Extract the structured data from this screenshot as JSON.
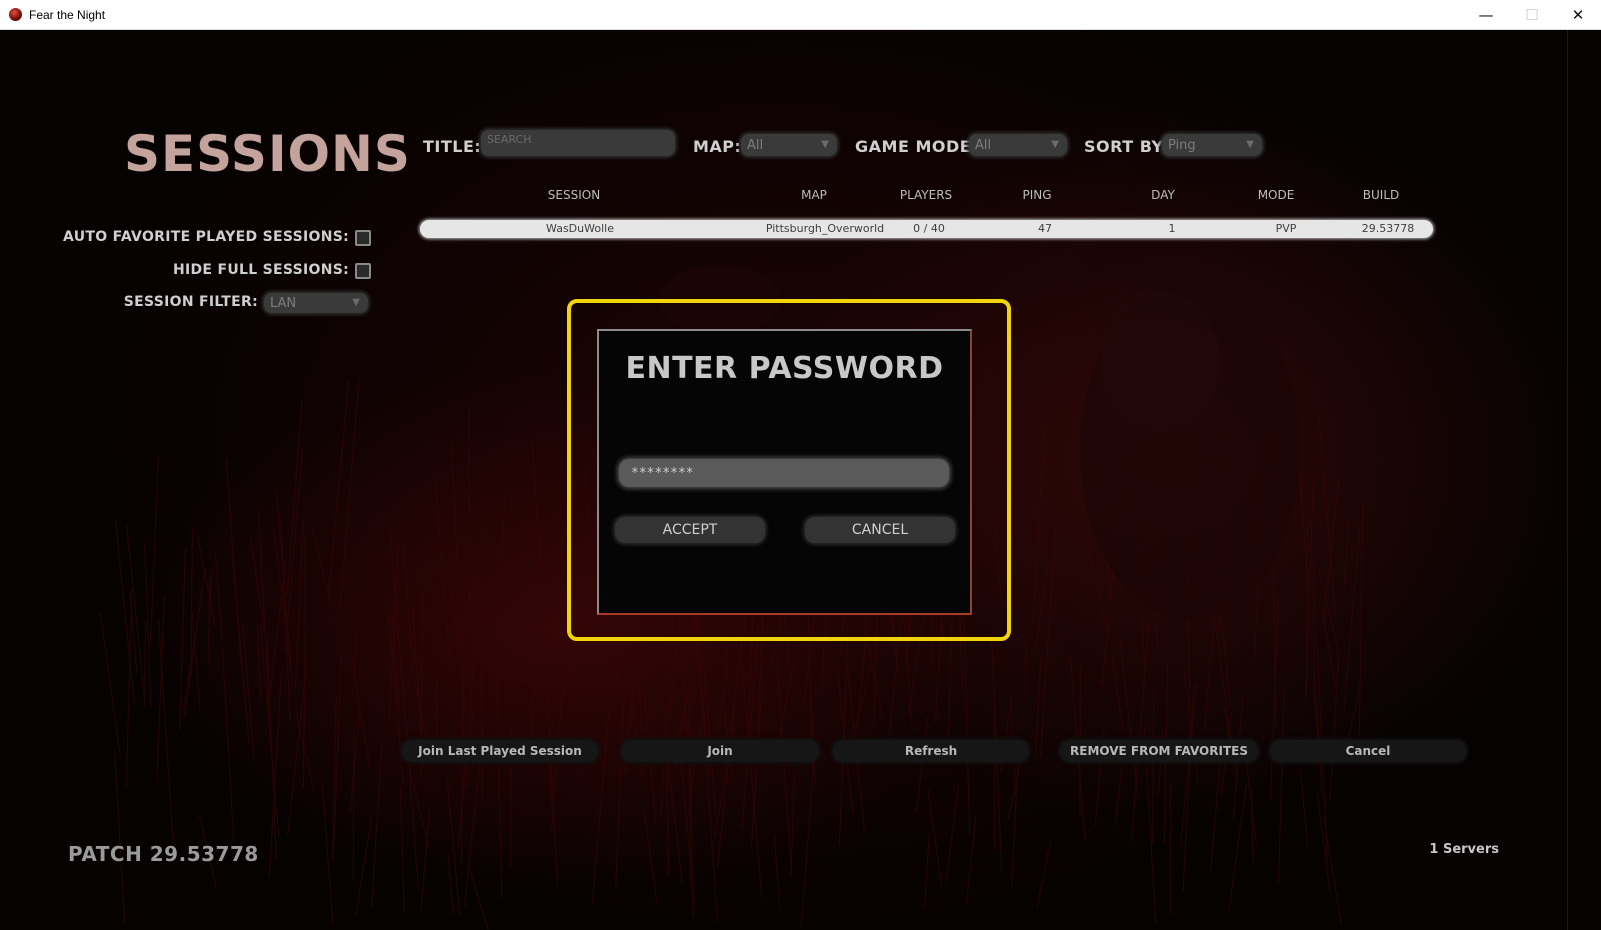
{
  "window": {
    "title": "Fear the Night",
    "minimize_glyph": "—",
    "maximize_glyph": "☐",
    "close_glyph": "✕"
  },
  "page": {
    "title": "SESSIONS"
  },
  "filters": {
    "title_label": "TITLE:",
    "title_placeholder": "SEARCH",
    "map_label": "MAP:",
    "map_value": "All",
    "game_mode_label": "GAME MODE:",
    "game_mode_value": "All",
    "sort_label": "SORT BY:",
    "sort_value": "Ping"
  },
  "table": {
    "columns": [
      "SESSION",
      "MAP",
      "PLAYERS",
      "PING",
      "DAY",
      "MODE",
      "BUILD"
    ],
    "rows": [
      [
        "WasDuWolle",
        "Pittsburgh_Overworld",
        "0 / 40",
        "47",
        "1",
        "PVP",
        "29.53778"
      ]
    ]
  },
  "sidebar": {
    "auto_favorite_label": "AUTO FAVORITE PLAYED SESSIONS:",
    "auto_favorite_checked": false,
    "hide_full_label": "HIDE FULL SESSIONS:",
    "hide_full_checked": false,
    "session_filter_label": "SESSION FILTER:",
    "session_filter_value": "LAN"
  },
  "dialog": {
    "title": "ENTER PASSWORD",
    "password_value": "********",
    "accept_label": "ACCEPT",
    "cancel_label": "CANCEL",
    "highlight_color": "#f2d40a"
  },
  "bottom_buttons": {
    "join_last": "Join Last Played Session",
    "join": "Join",
    "refresh": "Refresh",
    "remove_favorites": "REMOVE FROM FAVORITES",
    "cancel": "Cancel"
  },
  "footer": {
    "patch": "PATCH 29.53778",
    "servers": "1 Servers"
  },
  "icons": {
    "app": "game-app-icon",
    "dropdown": "chevron-down-icon"
  }
}
